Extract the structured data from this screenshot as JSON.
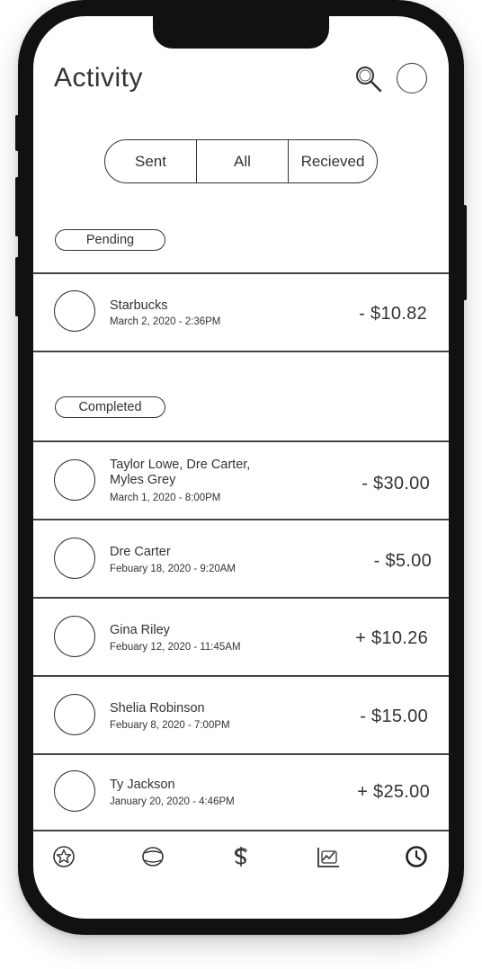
{
  "header": {
    "title": "Activity",
    "search_icon": "search-icon",
    "avatar_icon": "profile-avatar"
  },
  "filter": {
    "options": [
      "Sent",
      "All",
      "Recieved"
    ]
  },
  "pending": {
    "label": "Pending",
    "items": [
      {
        "name": "Starbucks",
        "date": "March 2, 2020 - 2:36PM",
        "amount": "- $10.82"
      }
    ]
  },
  "completed": {
    "label": "Completed",
    "items": [
      {
        "name": "Taylor Lowe, Dre Carter,\nMyles Grey",
        "date": "March 1, 2020 - 8:00PM",
        "amount": "- $30.00"
      },
      {
        "name": "Dre Carter",
        "date": "Febuary 18, 2020 - 9:20AM",
        "amount": "- $5.00"
      },
      {
        "name": "Gina Riley",
        "date": "Febuary 12, 2020 - 11:45AM",
        "amount": "+ $10.26"
      },
      {
        "name": "Shelia Robinson",
        "date": "Febuary 8, 2020 - 7:00PM",
        "amount": "- $15.00"
      },
      {
        "name": "Ty Jackson",
        "date": "January 20, 2020 - 4:46PM",
        "amount": "+ $25.00"
      }
    ]
  },
  "bottom_nav": {
    "icons": [
      "star-icon",
      "wallet-icon",
      "dollar-icon",
      "chart-icon",
      "clock-icon"
    ]
  }
}
